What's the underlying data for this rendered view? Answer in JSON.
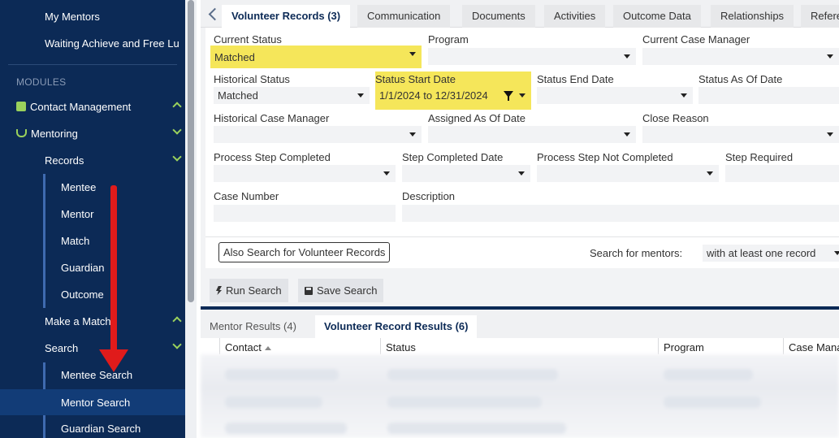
{
  "sidebar": {
    "top_items": [
      {
        "label": "My Mentors"
      },
      {
        "label": "Waiting Achieve and Free Lu"
      }
    ],
    "modules_heading": "MODULES",
    "contact_management": "Contact Management",
    "mentoring": "Mentoring",
    "records": "Records",
    "record_items": [
      "Mentee",
      "Mentor",
      "Match",
      "Guardian",
      "Outcome"
    ],
    "make_a_match": "Make a Match",
    "search": "Search",
    "search_items": [
      "Mentee Search",
      "Mentor Search",
      "Guardian Search"
    ]
  },
  "tabs": [
    {
      "label": "Volunteer Records (3)",
      "active": true
    },
    {
      "label": "Communication"
    },
    {
      "label": "Documents"
    },
    {
      "label": "Activities"
    },
    {
      "label": "Outcome Data"
    },
    {
      "label": "Relationships"
    },
    {
      "label": "Refere"
    }
  ],
  "form": {
    "current_status": {
      "label": "Current Status",
      "value": "Matched"
    },
    "program": {
      "label": "Program",
      "value": ""
    },
    "current_case_manager": {
      "label": "Current Case Manager",
      "value": ""
    },
    "historical_status": {
      "label": "Historical Status",
      "value": "Matched"
    },
    "status_start_date": {
      "label": "Status Start Date",
      "value": "1/1/2024 to 12/31/2024"
    },
    "status_end_date": {
      "label": "Status End Date",
      "value": ""
    },
    "status_as_of_date": {
      "label": "Status As Of Date",
      "value": ""
    },
    "historical_case_manager": {
      "label": "Historical Case Manager",
      "value": ""
    },
    "assigned_as_of_date": {
      "label": "Assigned As Of Date",
      "value": ""
    },
    "close_reason": {
      "label": "Close Reason",
      "value": ""
    },
    "process_step_completed": {
      "label": "Process Step Completed",
      "value": ""
    },
    "step_completed_date": {
      "label": "Step Completed Date",
      "value": ""
    },
    "process_step_not_completed": {
      "label": "Process Step Not Completed",
      "value": ""
    },
    "step_required": {
      "label": "Step Required",
      "value": ""
    },
    "case_number": {
      "label": "Case Number",
      "value": ""
    },
    "description": {
      "label": "Description",
      "value": ""
    },
    "also_search": "Also Search for Volunteer Records",
    "search_for_mentors_label": "Search for mentors:",
    "search_for_mentors_value": "with at least one record"
  },
  "actions": {
    "run_search": "Run Search",
    "save_search": "Save Search"
  },
  "result_tabs": [
    {
      "label": "Mentor Results (4)"
    },
    {
      "label": "Volunteer Record Results (6)",
      "active": true
    }
  ],
  "result_columns": [
    "Contact",
    "Status",
    "Program",
    "Case Mana"
  ],
  "colors": {
    "sidebar_bg": "#0c2a56",
    "accent_green": "#9ad15c",
    "highlight": "#f5e65a",
    "annotation_red": "#e01b1b"
  }
}
